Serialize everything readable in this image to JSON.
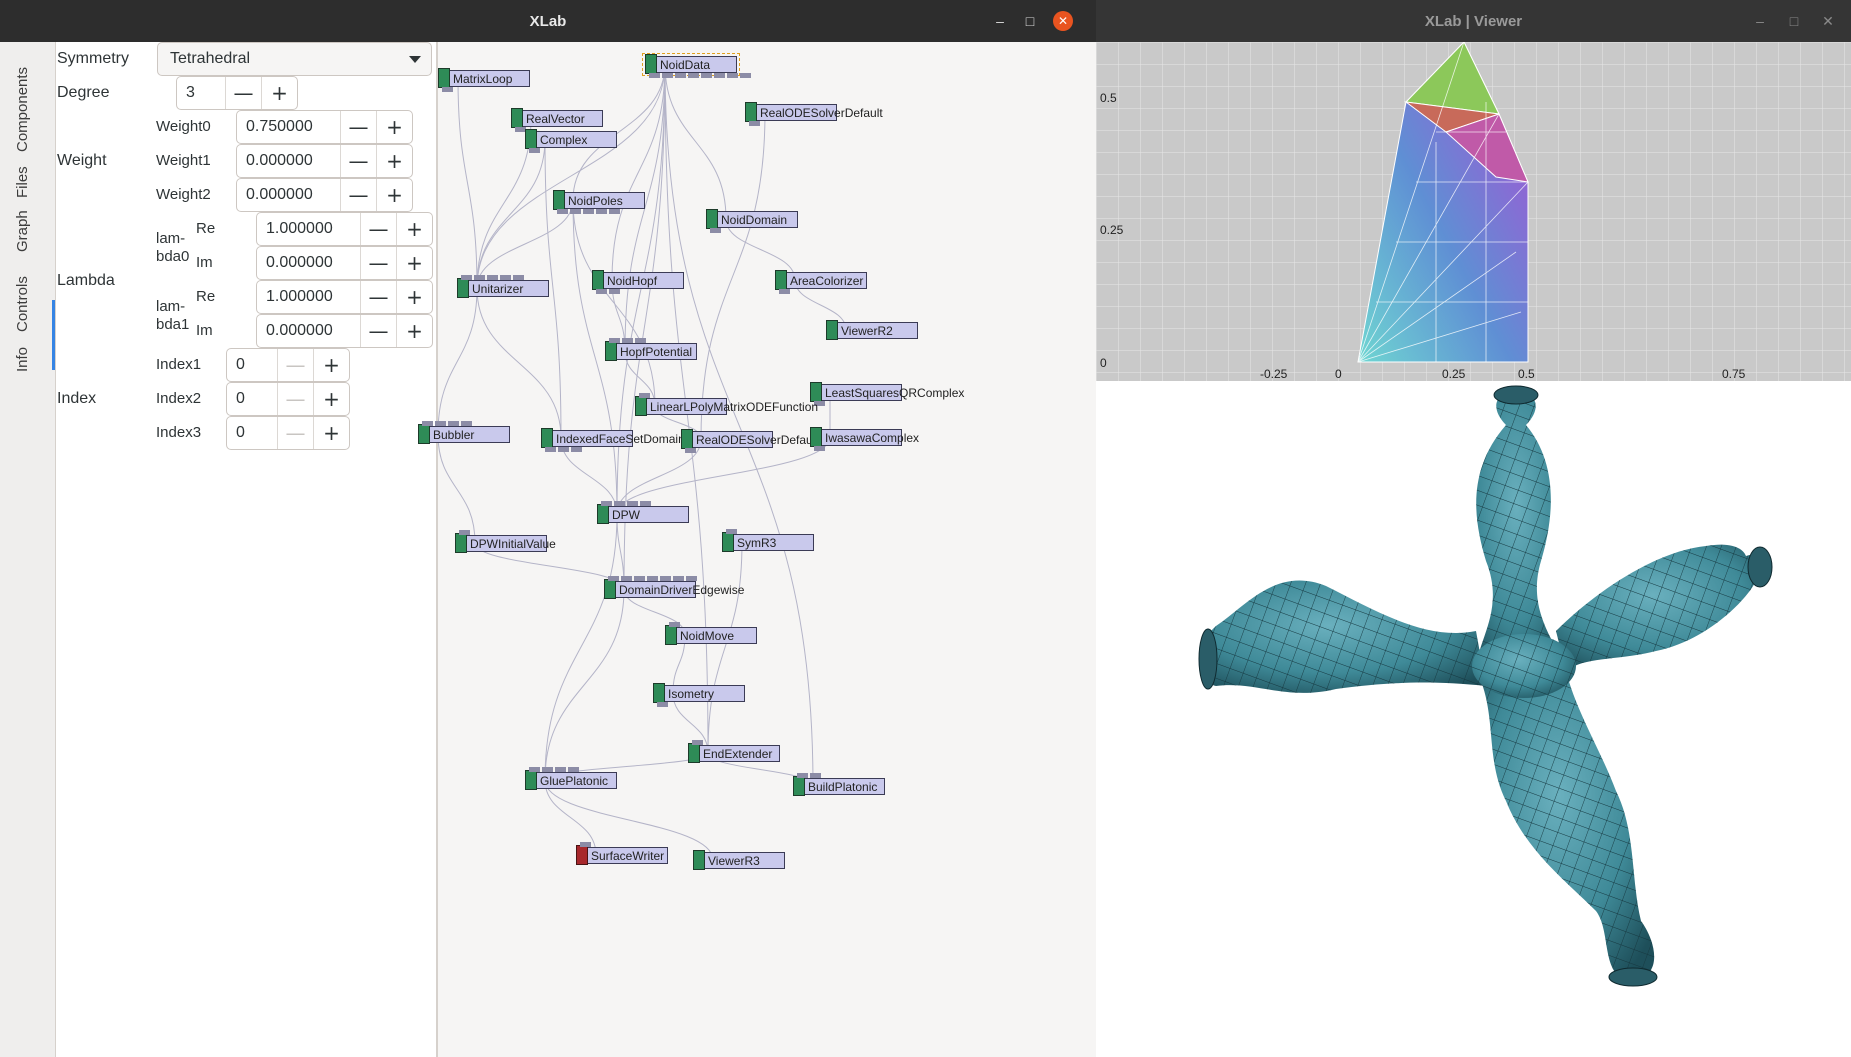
{
  "main_window": {
    "title": "XLab",
    "buttons": {
      "minimize": "–",
      "maximize": "□",
      "close": "✕"
    }
  },
  "side_tabs": [
    "Components",
    "Files",
    "Graph",
    "Controls",
    "Info"
  ],
  "active_tab": "Controls",
  "controls": {
    "symmetry": {
      "label": "Symmetry",
      "value": "Tetrahedral"
    },
    "degree": {
      "label": "Degree",
      "value": "3"
    },
    "weight": {
      "group_label": "Weight",
      "items": [
        {
          "label": "Weight0",
          "value": "0.750000"
        },
        {
          "label": "Weight1",
          "value": "0.000000"
        },
        {
          "label": "Weight2",
          "value": "0.000000"
        }
      ]
    },
    "lambda": {
      "group_label": "Lambda",
      "lambda0": {
        "label_line1": "lam-",
        "label_line2": "bda0",
        "re_label": "Re",
        "re": "1.000000",
        "im_label": "Im",
        "im": "0.000000"
      },
      "lambda1": {
        "label_line1": "lam-",
        "label_line2": "bda1",
        "re_label": "Re",
        "re": "1.000000",
        "im_label": "Im",
        "im": "0.000000"
      }
    },
    "index": {
      "group_label": "Index",
      "items": [
        {
          "label": "Index1",
          "value": "0"
        },
        {
          "label": "Index2",
          "value": "0"
        },
        {
          "label": "Index3",
          "value": "0"
        }
      ]
    },
    "minus": "—",
    "plus": "+"
  },
  "graph_nodes": [
    {
      "id": "n0",
      "name": "NoidData"
    },
    {
      "id": "n1",
      "name": "MatrixLoop"
    },
    {
      "id": "n2",
      "name": "RealVector"
    },
    {
      "id": "n3",
      "name": "Complex"
    },
    {
      "id": "n4",
      "name": "RealODESolverDefault"
    },
    {
      "id": "n5",
      "name": "NoidPoles"
    },
    {
      "id": "n6",
      "name": "NoidDomain"
    },
    {
      "id": "n7",
      "name": "Unitarizer"
    },
    {
      "id": "n8",
      "name": "NoidHopf"
    },
    {
      "id": "n9",
      "name": "AreaColorizer"
    },
    {
      "id": "n10",
      "name": "ViewerR2"
    },
    {
      "id": "n11",
      "name": "HopfPotential"
    },
    {
      "id": "n12",
      "name": "LeastSquaresQRComplex"
    },
    {
      "id": "n13",
      "name": "LinearLPolyMatrixODEFunction"
    },
    {
      "id": "n14",
      "name": "Bubbler"
    },
    {
      "id": "n15",
      "name": "IndexedFaceSetDomain"
    },
    {
      "id": "n16",
      "name": "RealODESolverDefault1"
    },
    {
      "id": "n17",
      "name": "IwasawaComplex"
    },
    {
      "id": "n18",
      "name": "DPW"
    },
    {
      "id": "n19",
      "name": "SymR3"
    },
    {
      "id": "n20",
      "name": "DPWInitialValue"
    },
    {
      "id": "n21",
      "name": "DomainDriverEdgewise"
    },
    {
      "id": "n22",
      "name": "NoidMove"
    },
    {
      "id": "n23",
      "name": "Isometry"
    },
    {
      "id": "n24",
      "name": "EndExtender"
    },
    {
      "id": "n25",
      "name": "GluePlatonic"
    },
    {
      "id": "n26",
      "name": "BuildPlatonic"
    },
    {
      "id": "n27",
      "name": "SurfaceWriter"
    },
    {
      "id": "n28",
      "name": "ViewerR3"
    }
  ],
  "viewer_window": {
    "title": "XLab | Viewer",
    "buttons": {
      "minimize": "–",
      "maximize": "□",
      "close": "✕"
    }
  },
  "plot2d": {
    "x_ticks": [
      "-0.25",
      "0",
      "0.25",
      "0.5",
      "0.75"
    ],
    "y_ticks": [
      "0.5",
      "0.25",
      "0"
    ]
  },
  "colors": {
    "accent": "#3584e4",
    "node_fill": "#c9c9ec",
    "node_marker": "#2e8b57",
    "node_marker_error": "#a8282c",
    "surface": "#4f9aa8"
  }
}
